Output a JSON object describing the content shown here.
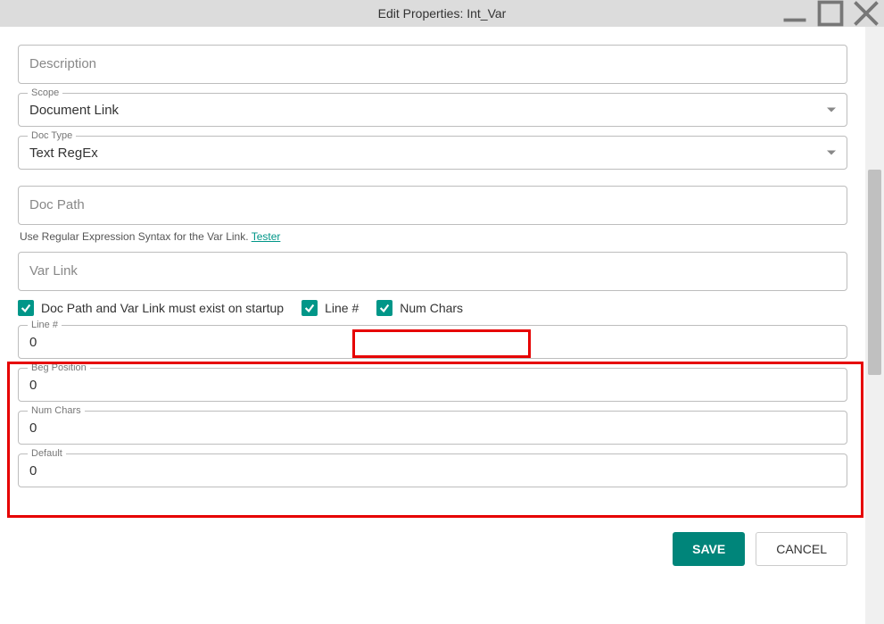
{
  "window": {
    "title": "Edit Properties: Int_Var"
  },
  "fields": {
    "description": {
      "placeholder": "Description"
    },
    "scope": {
      "label": "Scope",
      "value": "Document Link"
    },
    "doctype": {
      "label": "Doc Type",
      "value": "Text RegEx"
    },
    "docpath": {
      "placeholder": "Doc Path"
    },
    "varlink": {
      "placeholder": "Var Link"
    },
    "linenum": {
      "label": "Line #",
      "value": "0"
    },
    "begpos": {
      "label": "Beg Position",
      "value": "0"
    },
    "numchars": {
      "label": "Num Chars",
      "value": "0"
    },
    "default": {
      "label": "Default",
      "value": "0"
    }
  },
  "helper": {
    "text": "Use Regular Expression Syntax for the Var Link. ",
    "link": "Tester"
  },
  "checks": {
    "startup": "Doc Path and Var Link must exist on startup",
    "linenum": "Line #",
    "numchars": "Num Chars"
  },
  "buttons": {
    "save": "SAVE",
    "cancel": "CANCEL"
  }
}
